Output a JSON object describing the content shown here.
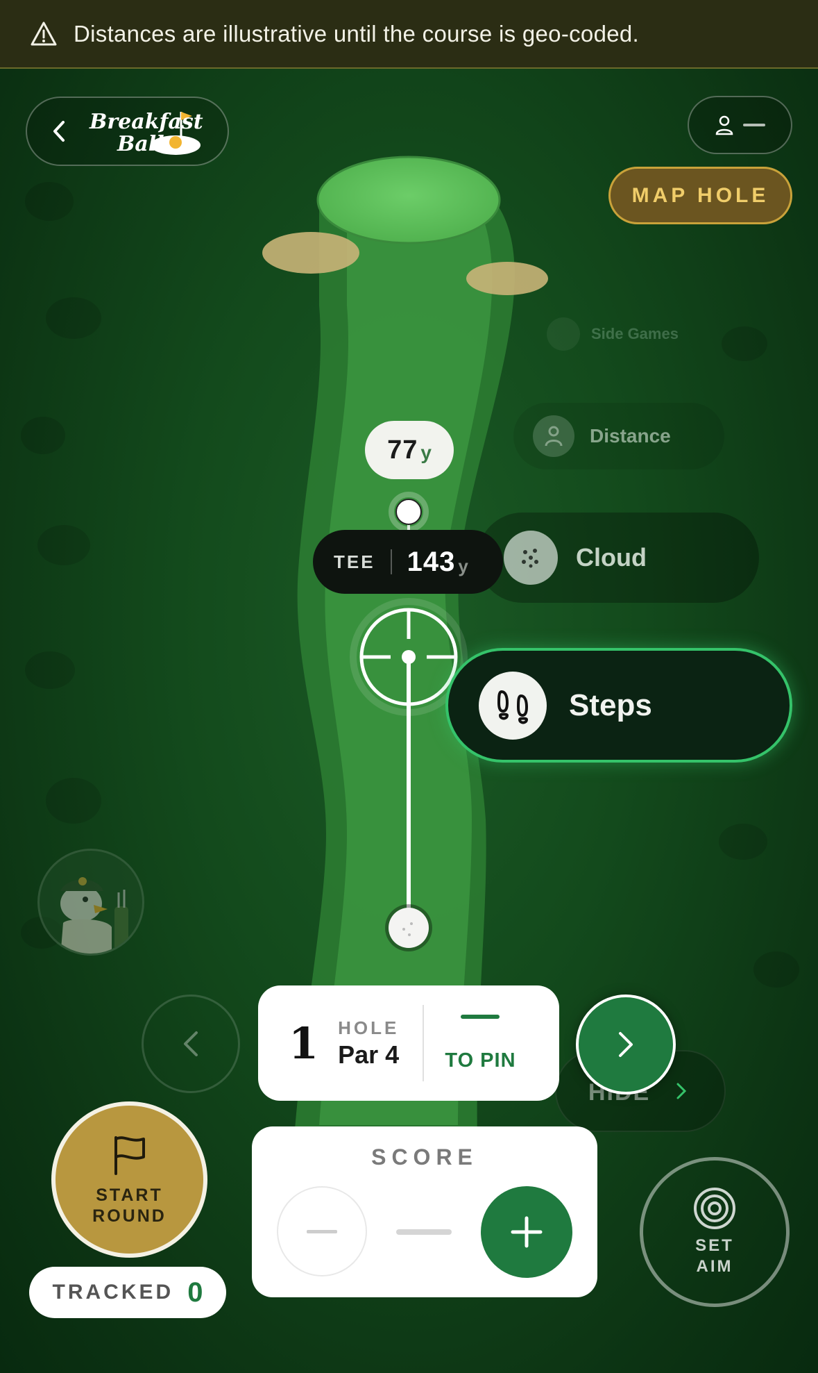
{
  "banner": {
    "text": "Distances are illustrative until the course is geo-coded.",
    "icon": "warning-triangle-icon"
  },
  "header": {
    "logo_line1": "Breakfast",
    "logo_line2": "Ball",
    "user_placeholder": "—"
  },
  "map_hole": {
    "label": "MAP HOLE"
  },
  "modes": {
    "side_games": "Side Games",
    "distance": "Distance",
    "cloud": "Cloud",
    "steps": "Steps"
  },
  "map": {
    "pin_distance": "77",
    "pin_unit": "y",
    "tee_label": "TEE",
    "tee_distance": "143",
    "tee_unit": "y"
  },
  "hole": {
    "number": "1",
    "label": "HOLE",
    "par": "Par 4",
    "to_pin_value": "—",
    "to_pin_label": "TO PIN"
  },
  "hide": {
    "label": "HIDE"
  },
  "start_round": {
    "line1": "START",
    "line2": "ROUND"
  },
  "tracked": {
    "label": "TRACKED",
    "count": "0"
  },
  "score": {
    "label": "SCORE",
    "value": "—"
  },
  "set_aim": {
    "line1": "SET",
    "line2": "AIM"
  },
  "colors": {
    "accent": "#1f7a3f",
    "gold": "#b8973f",
    "steps_border": "#35c36a"
  }
}
